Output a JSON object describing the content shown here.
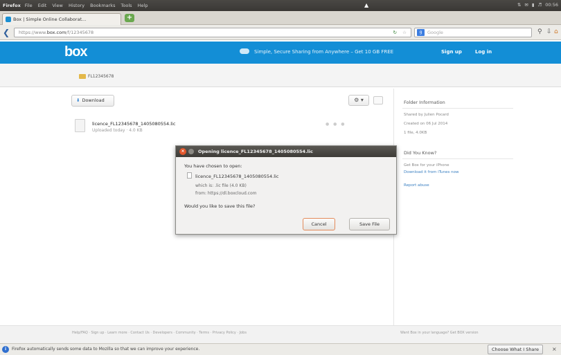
{
  "system_bar": {
    "app": "Firefox",
    "menu": [
      "File",
      "Edit",
      "View",
      "History",
      "Bookmarks",
      "Tools",
      "Help"
    ],
    "clock": "00:56"
  },
  "browser": {
    "tab_title": "Box | Simple Online Collaborat...",
    "url_prefix": "https://www.",
    "url_domain": "box.com",
    "url_path": "/f/12345678",
    "search_placeholder": "Google"
  },
  "box_header": {
    "logo": "box",
    "promo": "Simple, Secure Sharing from Anywhere – Get 10 GB FREE",
    "signup": "Sign up",
    "login": "Log in"
  },
  "breadcrumb": {
    "folder": "FL12345678"
  },
  "toolbar": {
    "download": "Download"
  },
  "file": {
    "name": "licence_FL12345678_1405080554.lic",
    "meta": "Uploaded today  ·  4.0 KB"
  },
  "sidebar": {
    "folder_info_heading": "Folder Information",
    "owner_line": "Shared by Julien Pocard",
    "created_line": "Created on 06 Jul 2014",
    "size_line": "1 file, 4.0KB",
    "did_you_know": "Did You Know?",
    "tip_line1": "Get Box for your iPhone",
    "tip_link": "Download it from iTunes now",
    "report_abuse": "Report abuse"
  },
  "dialog": {
    "title": "Opening licence_FL12345678_1405080554.lic",
    "chosen": "You have chosen to open:",
    "filename": "licence_FL12345678_1405080554.lic",
    "which_is": "which is: .lic file (4.0 KB)",
    "from": "from: https://dl.boxcloud.com",
    "question": "Would you like to save this file?",
    "cancel": "Cancel",
    "save": "Save File"
  },
  "footer": {
    "links": "Help/FAQ  ·  Sign up  ·  Learn more  ·  Contact Us  ·  Developers  ·  Community  ·  Terms  ·  Privacy Policy  ·  Jobs",
    "language": "Want Box in your language?  Get BOX version"
  },
  "notification": {
    "text": "Firefox automatically sends some data to Mozilla so that we can improve your experience.",
    "choose": "Choose What I Share"
  }
}
